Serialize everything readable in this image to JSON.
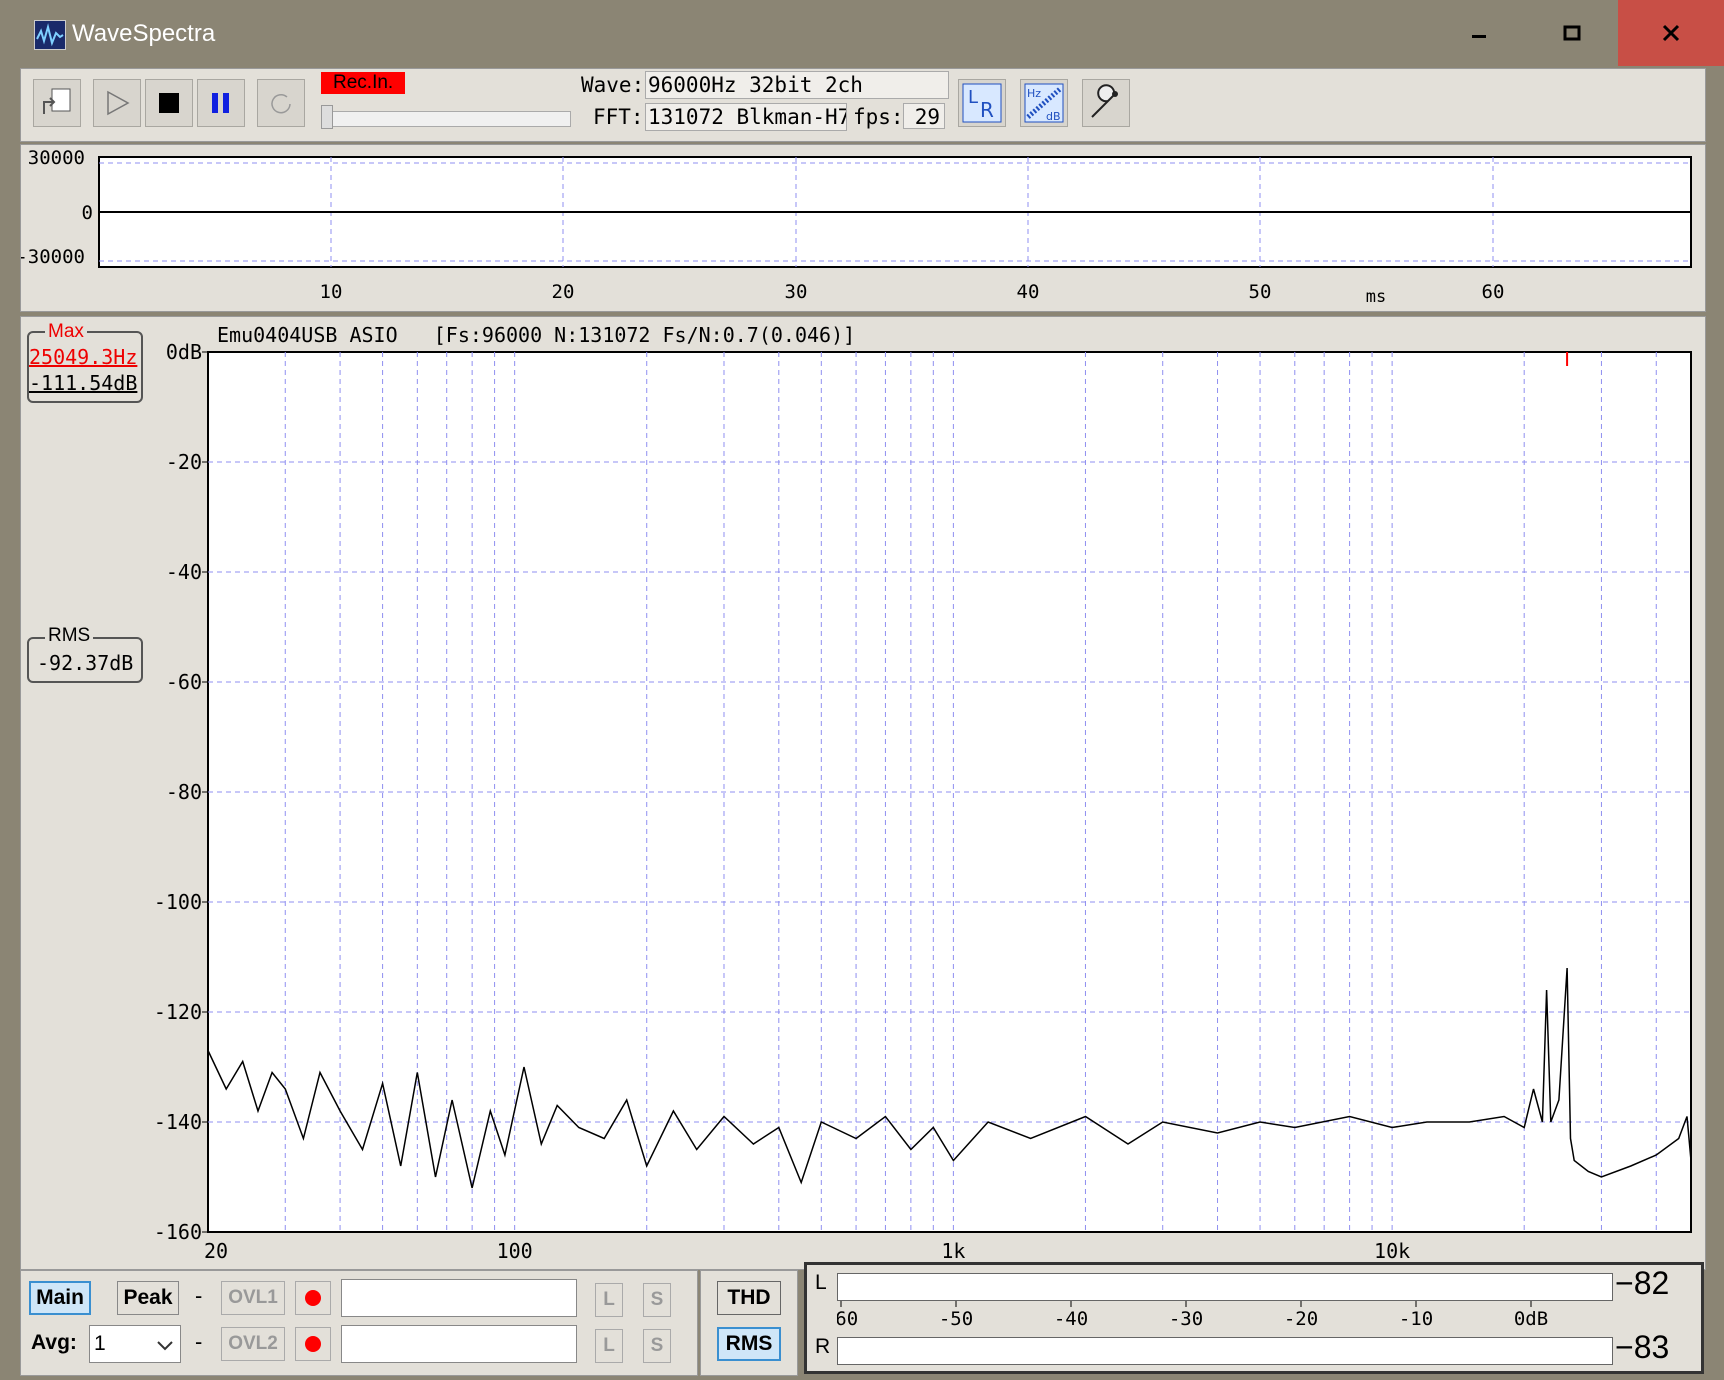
{
  "window": {
    "title": "WaveSpectra",
    "min_icon": "minimize-icon",
    "max_icon": "maximize-icon",
    "close_icon": "close-icon"
  },
  "toolbar": {
    "rec_label": "Rec.In.",
    "wave_label": "Wave:",
    "wave_value": "96000Hz 32bit 2ch",
    "fft_label": "FFT:",
    "fft_value": "131072 Blkman-H7",
    "fps_label": "fps:",
    "fps_value": "29",
    "lr_label_l": "L",
    "lr_label_r": "R",
    "hz_label": "Hz",
    "db_label": "dB"
  },
  "wave_chart": {
    "y_ticks": [
      "30000",
      "0",
      "-30000"
    ],
    "x_ticks": [
      "10",
      "20",
      "30",
      "40",
      "50",
      "60"
    ],
    "x_unit": "ms"
  },
  "spectrum": {
    "header": "Emu0404USB ASIO   [Fs:96000 N:131072 Fs/N:0.7(0.046)]",
    "max_title": "Max",
    "max_freq": "25049.3Hz",
    "max_db": "-111.54dB",
    "rms_title": "RMS",
    "rms_db": "-92.37dB"
  },
  "chart_data": {
    "type": "line",
    "xscale": "log",
    "xlim": [
      20,
      48000
    ],
    "ylim": [
      -160,
      0
    ],
    "x_tick_labels": [
      "20",
      "100",
      "1k",
      "10k"
    ],
    "y_tick_labels": [
      "0dB",
      "-20",
      "-40",
      "-60",
      "-80",
      "-100",
      "-120",
      "-140",
      "-160"
    ],
    "grid": true,
    "series": [
      {
        "x": [
          20,
          22,
          24,
          26,
          28,
          30,
          33,
          36,
          40,
          45,
          50,
          55,
          60,
          66,
          72,
          80,
          88,
          95,
          105,
          115,
          125,
          140,
          160,
          180,
          200,
          230,
          260,
          300,
          350,
          400,
          450,
          500,
          600,
          700,
          800,
          900,
          1000,
          1200,
          1500,
          2000,
          2500,
          3000,
          4000,
          5000,
          6000,
          8000,
          10000,
          12000,
          15000,
          18000,
          20000,
          21000,
          22000,
          22500,
          23000,
          24000,
          25049,
          25500,
          26000,
          28000,
          30000,
          35000,
          40000,
          45000,
          47000,
          48000
        ],
        "y": [
          -127,
          -134,
          -129,
          -138,
          -131,
          -134,
          -143,
          -131,
          -138,
          -145,
          -133,
          -148,
          -131,
          -150,
          -136,
          -152,
          -138,
          -146,
          -130,
          -144,
          -137,
          -141,
          -143,
          -136,
          -148,
          -138,
          -145,
          -139,
          -144,
          -141,
          -151,
          -140,
          -143,
          -139,
          -145,
          -141,
          -147,
          -140,
          -143,
          -139,
          -144,
          -140,
          -142,
          -140,
          -141,
          -139,
          -141,
          -140,
          -140,
          -139,
          -141,
          -134,
          -140,
          -116,
          -140,
          -136,
          -112,
          -143,
          -147,
          -149,
          -150,
          -148,
          -146,
          -143,
          -139,
          -147
        ],
        "color": "#000000"
      }
    ],
    "markers": [
      {
        "x": 25049.3,
        "color": "#ff0000"
      }
    ]
  },
  "bottom": {
    "main_label": "Main",
    "peak_label": "Peak",
    "dash1": "-",
    "dash2": "-",
    "avg_label": "Avg:",
    "avg_value": "1",
    "ovl1_label": "OVL1",
    "ovl2_label": "OVL2",
    "l_label": "L",
    "s_label": "S",
    "thd_label": "THD",
    "rms_label": "RMS"
  },
  "meter": {
    "l_label": "L",
    "r_label": "R",
    "l_value": "−82",
    "r_value": "−83",
    "ticks": [
      "-60",
      "-50",
      "-40",
      "-30",
      "-20",
      "-10",
      "0dB"
    ]
  }
}
